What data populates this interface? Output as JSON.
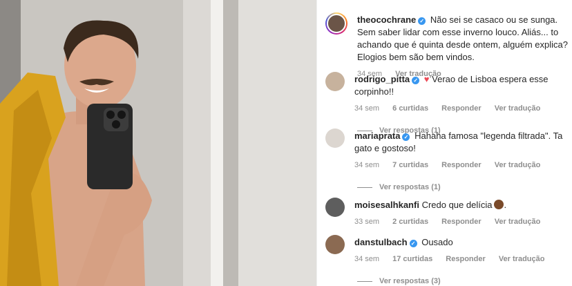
{
  "caption": {
    "username": "theocochrane",
    "text": "Não sei se casaco ou se sunga. Sem saber lidar com esse inverno louco. Aliás... to achando que é quinta desde ontem, alguém explica? Elogios bem são bem vindos.",
    "time": "34 sem",
    "translate": "Ver tradução"
  },
  "comments": [
    {
      "username": "rodrigo_pitta",
      "text": "Verao de Lisboa espera esse corpinho!!",
      "time": "34 sem",
      "likes": "6 curtidas",
      "reply": "Responder",
      "translate": "Ver tradução",
      "view_replies": "Ver respostas (1)"
    },
    {
      "username": "mariaprata",
      "text": "Hahaha famosa \"legenda filtrada\". Ta gato e gostoso!",
      "time": "34 sem",
      "likes": "7 curtidas",
      "reply": "Responder",
      "translate": "Ver tradução",
      "view_replies": "Ver respostas (1)"
    },
    {
      "username": "moisesalhkanfi",
      "text": "Credo que delícia",
      "time": "33 sem",
      "likes": "2 curtidas",
      "reply": "Responder",
      "translate": "Ver tradução"
    },
    {
      "username": "danstulbach",
      "text": "Ousado",
      "time": "34 sem",
      "likes": "17 curtidas",
      "reply": "Responder",
      "translate": "Ver tradução",
      "view_replies": "Ver respostas (3)"
    }
  ],
  "colors": {
    "verified": "#3897f0",
    "heart": "#ed4956",
    "meta": "#8e8e8e"
  }
}
